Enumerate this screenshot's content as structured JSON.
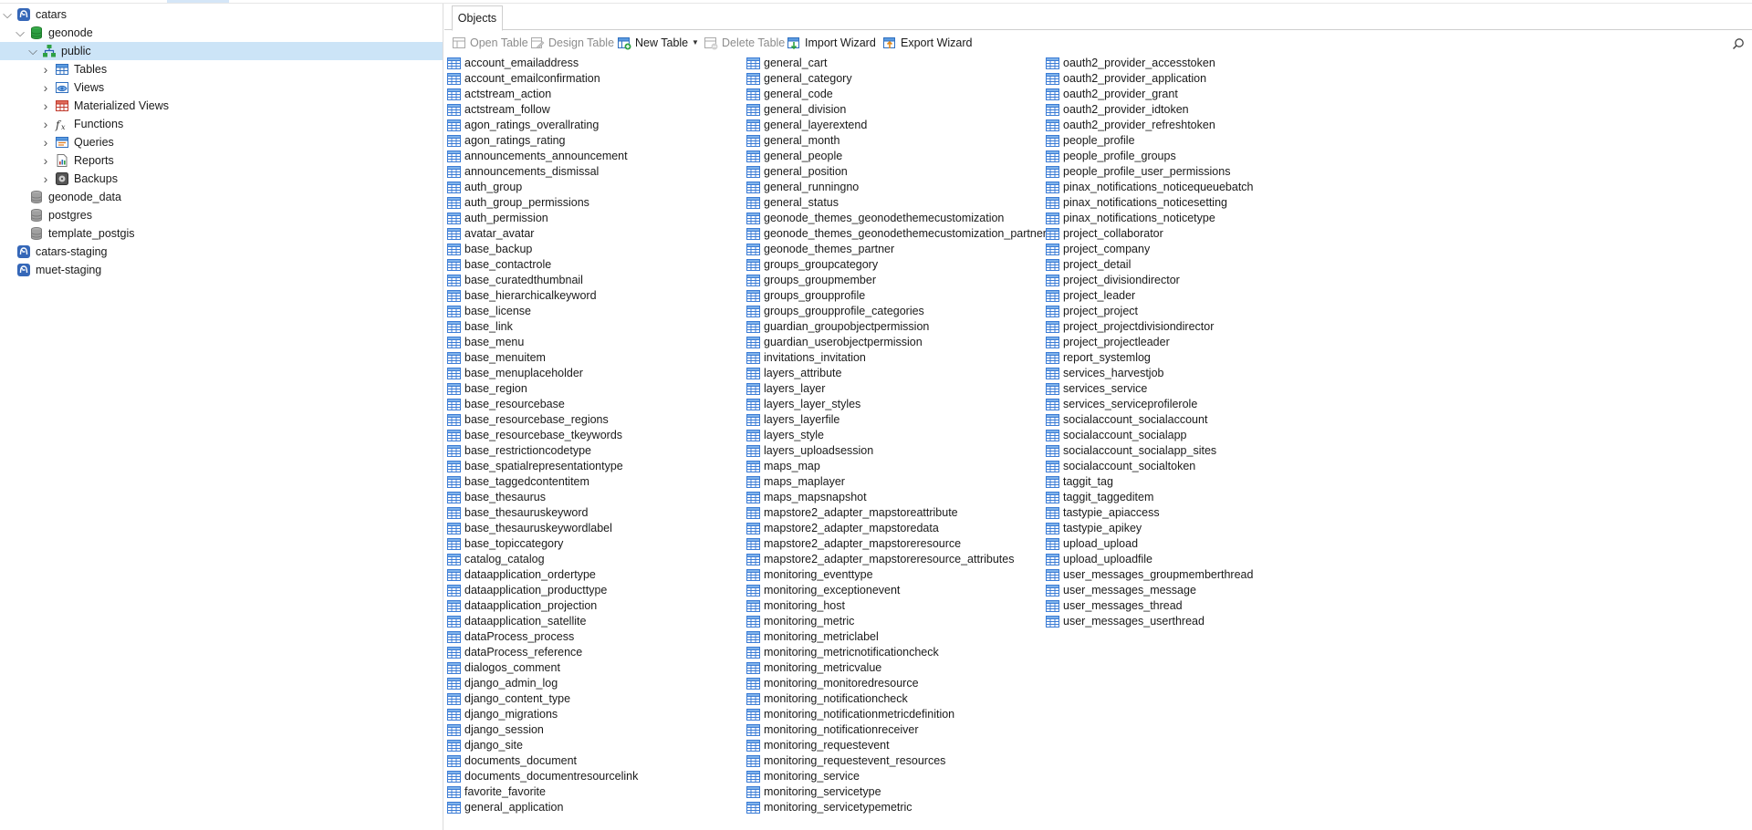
{
  "tree": [
    {
      "label": "catars",
      "caret": "expanded",
      "icon": "connection-icon",
      "name": "tree-connection-catars"
    },
    {
      "label": "geonode",
      "caret": "expanded",
      "icon": "database-open-icon",
      "name": "tree-database-geonode"
    },
    {
      "label": "public",
      "caret": "expanded",
      "icon": "schema-icon",
      "name": "tree-schema-public",
      "selected": true
    },
    {
      "label": "Tables",
      "caret": "collapsed",
      "icon": "tables-icon",
      "name": "tree-item-tables"
    },
    {
      "label": "Views",
      "caret": "collapsed",
      "icon": "views-icon",
      "name": "tree-item-views"
    },
    {
      "label": "Materialized Views",
      "caret": "collapsed",
      "icon": "materialized-views-icon",
      "name": "tree-item-materialized-views"
    },
    {
      "label": "Functions",
      "caret": "collapsed",
      "icon": "functions-icon",
      "name": "tree-item-functions"
    },
    {
      "label": "Queries",
      "caret": "collapsed",
      "icon": "queries-icon",
      "name": "tree-item-queries"
    },
    {
      "label": "Reports",
      "caret": "collapsed",
      "icon": "reports-icon",
      "name": "tree-item-reports"
    },
    {
      "label": "Backups",
      "caret": "collapsed",
      "icon": "backups-icon",
      "name": "tree-item-backups"
    },
    {
      "label": "geonode_data",
      "caret": "none",
      "icon": "database-icon",
      "name": "tree-database-geonode-data"
    },
    {
      "label": "postgres",
      "caret": "none",
      "icon": "database-icon",
      "name": "tree-database-postgres"
    },
    {
      "label": "template_postgis",
      "caret": "none",
      "icon": "database-icon",
      "name": "tree-database-template-postgis"
    },
    {
      "label": "catars-staging",
      "caret": "none",
      "icon": "connection-icon",
      "name": "tree-connection-catars-staging"
    },
    {
      "label": "muet-staging",
      "caret": "none",
      "icon": "connection-icon",
      "name": "tree-connection-muet-staging"
    }
  ],
  "tabs": {
    "objects": "Objects"
  },
  "toolbar": {
    "open_table": "Open Table",
    "design_table": "Design Table",
    "new_table": "New Table",
    "delete_table": "Delete Table",
    "import_wizard": "Import Wizard",
    "export_wizard": "Export Wizard"
  },
  "objects": {
    "columns": [
      [
        "account_emailaddress",
        "account_emailconfirmation",
        "actstream_action",
        "actstream_follow",
        "agon_ratings_overallrating",
        "agon_ratings_rating",
        "announcements_announcement",
        "announcements_dismissal",
        "auth_group",
        "auth_group_permissions",
        "auth_permission",
        "avatar_avatar",
        "base_backup",
        "base_contactrole",
        "base_curatedthumbnail",
        "base_hierarchicalkeyword",
        "base_license",
        "base_link",
        "base_menu",
        "base_menuitem",
        "base_menuplaceholder",
        "base_region",
        "base_resourcebase",
        "base_resourcebase_regions",
        "base_resourcebase_tkeywords",
        "base_restrictioncodetype",
        "base_spatialrepresentationtype",
        "base_taggedcontentitem",
        "base_thesaurus",
        "base_thesauruskeyword",
        "base_thesauruskeywordlabel",
        "base_topiccategory",
        "catalog_catalog",
        "dataapplication_ordertype",
        "dataapplication_producttype",
        "dataapplication_projection",
        "dataapplication_satellite",
        "dataProcess_process",
        "dataProcess_reference",
        "dialogos_comment",
        "django_admin_log",
        "django_content_type",
        "django_migrations",
        "django_session",
        "django_site",
        "documents_document",
        "documents_documentresourcelink",
        "favorite_favorite",
        "general_application"
      ],
      [
        "general_cart",
        "general_category",
        "general_code",
        "general_division",
        "general_layerextend",
        "general_month",
        "general_people",
        "general_position",
        "general_runningno",
        "general_status",
        "geonode_themes_geonodethemecustomization",
        "geonode_themes_geonodethemecustomization_partners",
        "geonode_themes_partner",
        "groups_groupcategory",
        "groups_groupmember",
        "groups_groupprofile",
        "groups_groupprofile_categories",
        "guardian_groupobjectpermission",
        "guardian_userobjectpermission",
        "invitations_invitation",
        "layers_attribute",
        "layers_layer",
        "layers_layer_styles",
        "layers_layerfile",
        "layers_style",
        "layers_uploadsession",
        "maps_map",
        "maps_maplayer",
        "maps_mapsnapshot",
        "mapstore2_adapter_mapstoreattribute",
        "mapstore2_adapter_mapstoredata",
        "mapstore2_adapter_mapstoreresource",
        "mapstore2_adapter_mapstoreresource_attributes",
        "monitoring_eventtype",
        "monitoring_exceptionevent",
        "monitoring_host",
        "monitoring_metric",
        "monitoring_metriclabel",
        "monitoring_metricnotificationcheck",
        "monitoring_metricvalue",
        "monitoring_monitoredresource",
        "monitoring_notificationcheck",
        "monitoring_notificationmetricdefinition",
        "monitoring_notificationreceiver",
        "monitoring_requestevent",
        "monitoring_requestevent_resources",
        "monitoring_service",
        "monitoring_servicetype",
        "monitoring_servicetypemetric"
      ],
      [
        "oauth2_provider_accesstoken",
        "oauth2_provider_application",
        "oauth2_provider_grant",
        "oauth2_provider_idtoken",
        "oauth2_provider_refreshtoken",
        "people_profile",
        "people_profile_groups",
        "people_profile_user_permissions",
        "pinax_notifications_noticequeuebatch",
        "pinax_notifications_noticesetting",
        "pinax_notifications_noticetype",
        "project_collaborator",
        "project_company",
        "project_detail",
        "project_divisiondirector",
        "project_leader",
        "project_project",
        "project_projectdivisiondirector",
        "project_projectleader",
        "report_systemlog",
        "services_harvestjob",
        "services_service",
        "services_serviceprofilerole",
        "socialaccount_socialaccount",
        "socialaccount_socialapp",
        "socialaccount_socialapp_sites",
        "socialaccount_socialtoken",
        "taggit_tag",
        "taggit_taggeditem",
        "tastypie_apiaccess",
        "tastypie_apikey",
        "upload_upload",
        "upload_uploadfile",
        "user_messages_groupmemberthread",
        "user_messages_message",
        "user_messages_thread",
        "user_messages_userthread"
      ]
    ]
  },
  "colors": {
    "selection": "#cce4f7",
    "table_icon": "#3a7bd5",
    "database_icon": "#2ea043"
  }
}
